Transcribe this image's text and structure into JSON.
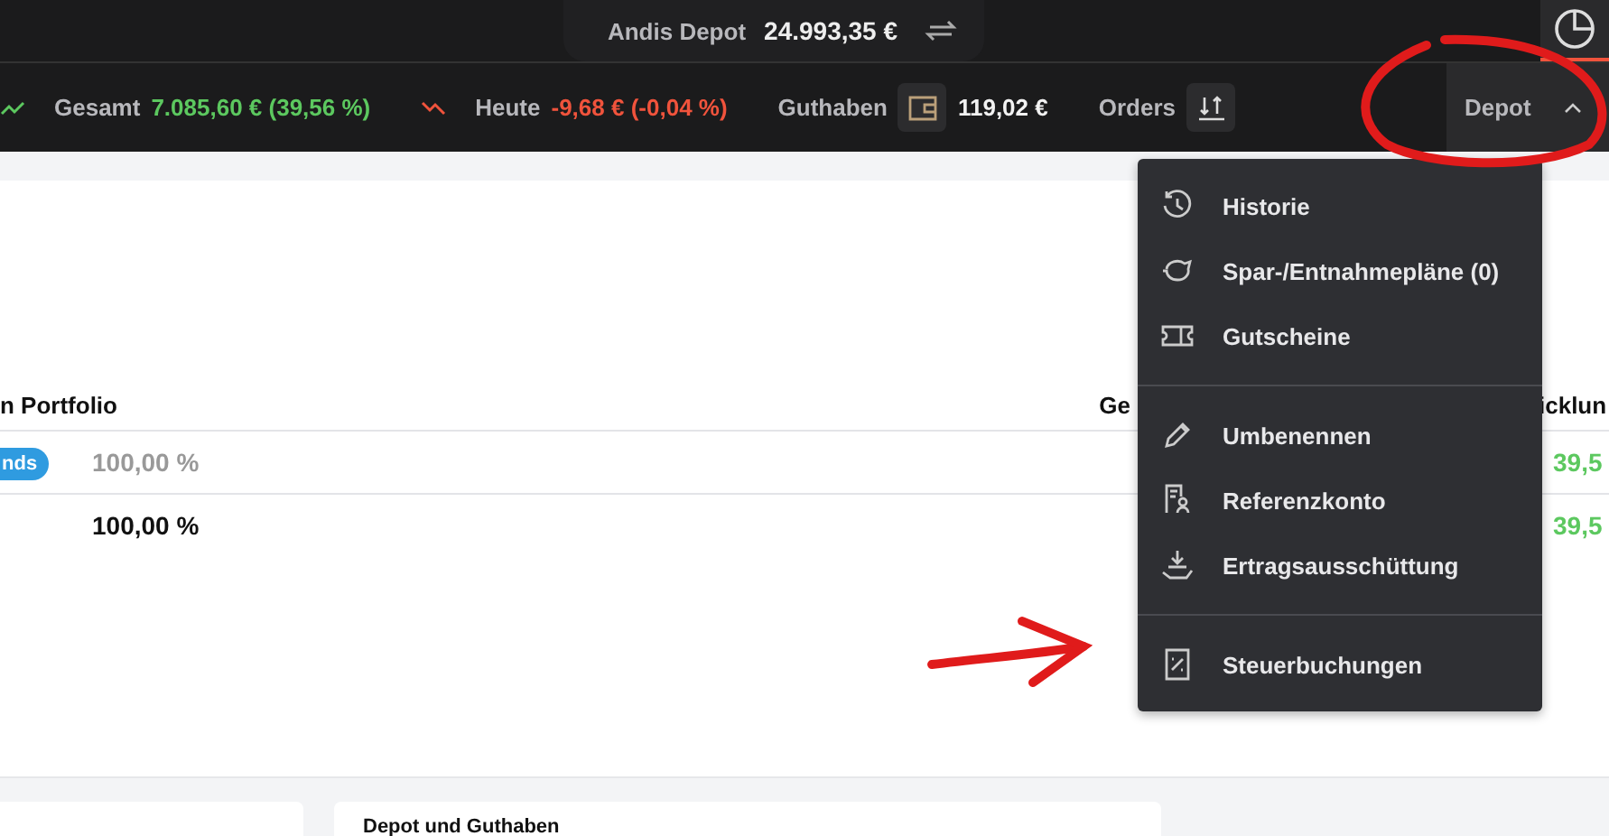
{
  "top_bar": {
    "account_name": "Andis Depot",
    "balance": "24.993,35 €",
    "tabs": [
      {
        "selected": true
      }
    ]
  },
  "stats_bar": {
    "items": [
      {
        "kind": "gain",
        "label": "Gesamt",
        "value": "7.085,60 € (39,56 %)"
      },
      {
        "kind": "loss",
        "label": "Heute",
        "value": "-9,68 € (-0,04 %)"
      },
      {
        "kind": "balance",
        "label": "Guthaben",
        "value": "119,02 €"
      },
      {
        "kind": "orders",
        "label": "Orders"
      }
    ],
    "depot_button": {
      "label": "Depot",
      "expanded": true
    }
  },
  "depot_menu": {
    "groups": [
      [
        {
          "label": "Historie"
        },
        {
          "label": "Spar-/Entnahmepläne (0)"
        },
        {
          "label": "Gutscheine"
        }
      ],
      [
        {
          "label": "Umbenennen"
        },
        {
          "label": "Referenzkonto"
        },
        {
          "label": "Ertragsausschüttung"
        }
      ],
      [
        {
          "label": "Steuerbuchungen"
        }
      ]
    ]
  },
  "table": {
    "columns": [
      "n Portfolio",
      "Ge",
      "icklun"
    ],
    "rows": [
      {
        "kind": "position",
        "tag": "nds",
        "share": "100,00 %",
        "change": "39,5"
      },
      {
        "kind": "total",
        "share": "100,00 %",
        "change": "39,5"
      }
    ]
  },
  "bottom_cards": [
    {
      "kind": "blank"
    },
    {
      "kind": "titled",
      "title": "Depot und Guthaben"
    }
  ]
}
